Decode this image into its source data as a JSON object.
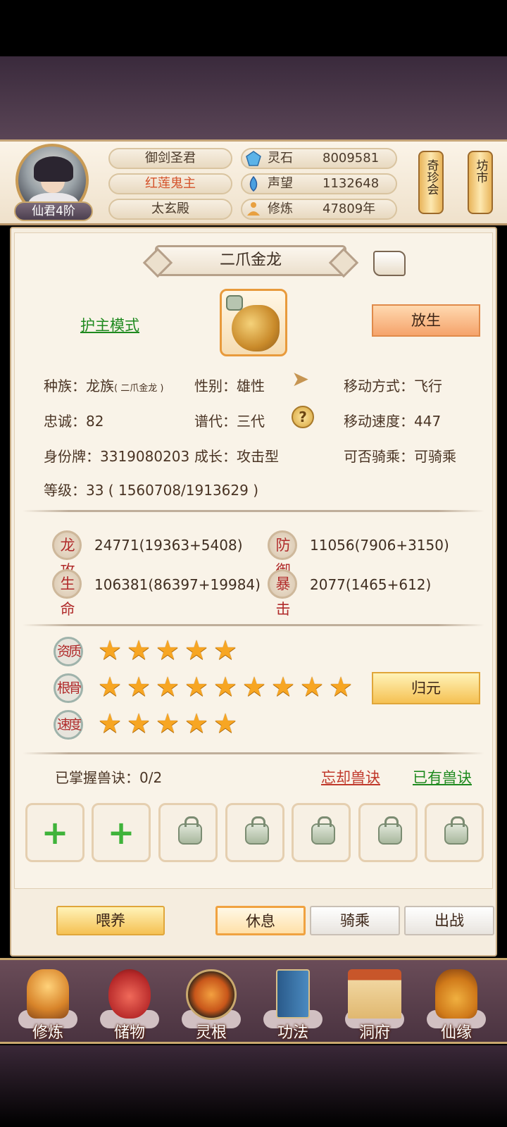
{
  "header": {
    "rank": "仙君4阶",
    "names": [
      "御剑圣君",
      "红莲鬼主",
      "太玄殿"
    ],
    "resources": [
      {
        "label": "灵石",
        "value": "8009581",
        "icon": "spirit-stone-icon"
      },
      {
        "label": "声望",
        "value": "1132648",
        "icon": "reputation-icon"
      },
      {
        "label": "修炼",
        "value": "47809年",
        "icon": "meditation-icon"
      }
    ],
    "scrolls": [
      "奇珍会",
      "坊市"
    ]
  },
  "beast": {
    "name": "二爪金龙",
    "mode_link": "护主模式",
    "release_button": "放生",
    "info": {
      "race_label": "种族：",
      "race_value": "龙族",
      "race_sub": "( 二爪金龙 )",
      "gender": "性别：雄性",
      "move_type": "移动方式：飞行",
      "loyalty": "忠诚：82",
      "generation": "谱代：三代",
      "move_speed": "移动速度：447",
      "id_tag": "身份牌：3319080203",
      "growth": "成长：攻击型",
      "rideable": "可否骑乘：可骑乘",
      "level": "等级：33 ( 1560708/1913629 )"
    },
    "stats": [
      {
        "seal": "龙攻",
        "value": "24771(19363+5408)"
      },
      {
        "seal": "防御",
        "value": "11056(7906+3150)"
      },
      {
        "seal": "生命",
        "value": "106381(86397+19984)"
      },
      {
        "seal": "暴击",
        "value": "2077(1465+612)"
      }
    ],
    "aptitudes": [
      {
        "seal": "资质",
        "stars": 5
      },
      {
        "seal": "根骨",
        "stars": 9
      },
      {
        "seal": "速度",
        "stars": 5
      }
    ],
    "return_button": "归元",
    "skills": {
      "mastered": "已掌握兽诀：0/2",
      "forget_link": "忘却兽诀",
      "owned_link": "已有兽诀",
      "slots": [
        "plus",
        "plus",
        "lock",
        "lock",
        "lock",
        "lock",
        "lock"
      ]
    }
  },
  "actions": {
    "feed": "喂养",
    "rest": "休息",
    "ride": "骑乘",
    "battle": "出战"
  },
  "nav": [
    "修炼",
    "储物",
    "灵根",
    "功法",
    "洞府",
    "仙缘"
  ]
}
